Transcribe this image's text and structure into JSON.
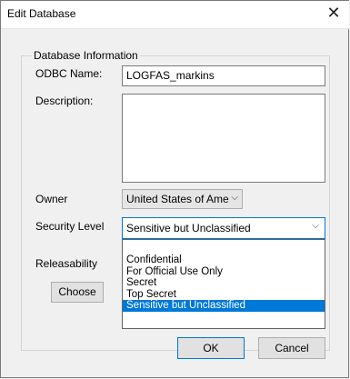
{
  "dialog": {
    "title": "Edit Database",
    "close_glyph": "✕"
  },
  "group": {
    "legend": "Database Information"
  },
  "fields": {
    "odbc_label": "ODBC Name:",
    "odbc_value": "LOGFAS_markins",
    "description_label": "Description:",
    "description_value": "",
    "owner_label": "Owner",
    "owner_value": "United States of Ame",
    "security_label": "Security Level",
    "security_value": "Sensitive but Unclassified",
    "releasability_label": "Releasability"
  },
  "security_options": [
    "Confidential",
    "For Official Use Only",
    "Secret",
    "Top Secret",
    "Sensitive but Unclassified"
  ],
  "selected_security_index": 4,
  "buttons": {
    "choose": "Choose",
    "ok": "OK",
    "cancel": "Cancel"
  },
  "icons": {
    "dropdown_arrow": "chevron-down-icon",
    "close": "close-icon"
  },
  "colors": {
    "accent": "#0078d7"
  }
}
